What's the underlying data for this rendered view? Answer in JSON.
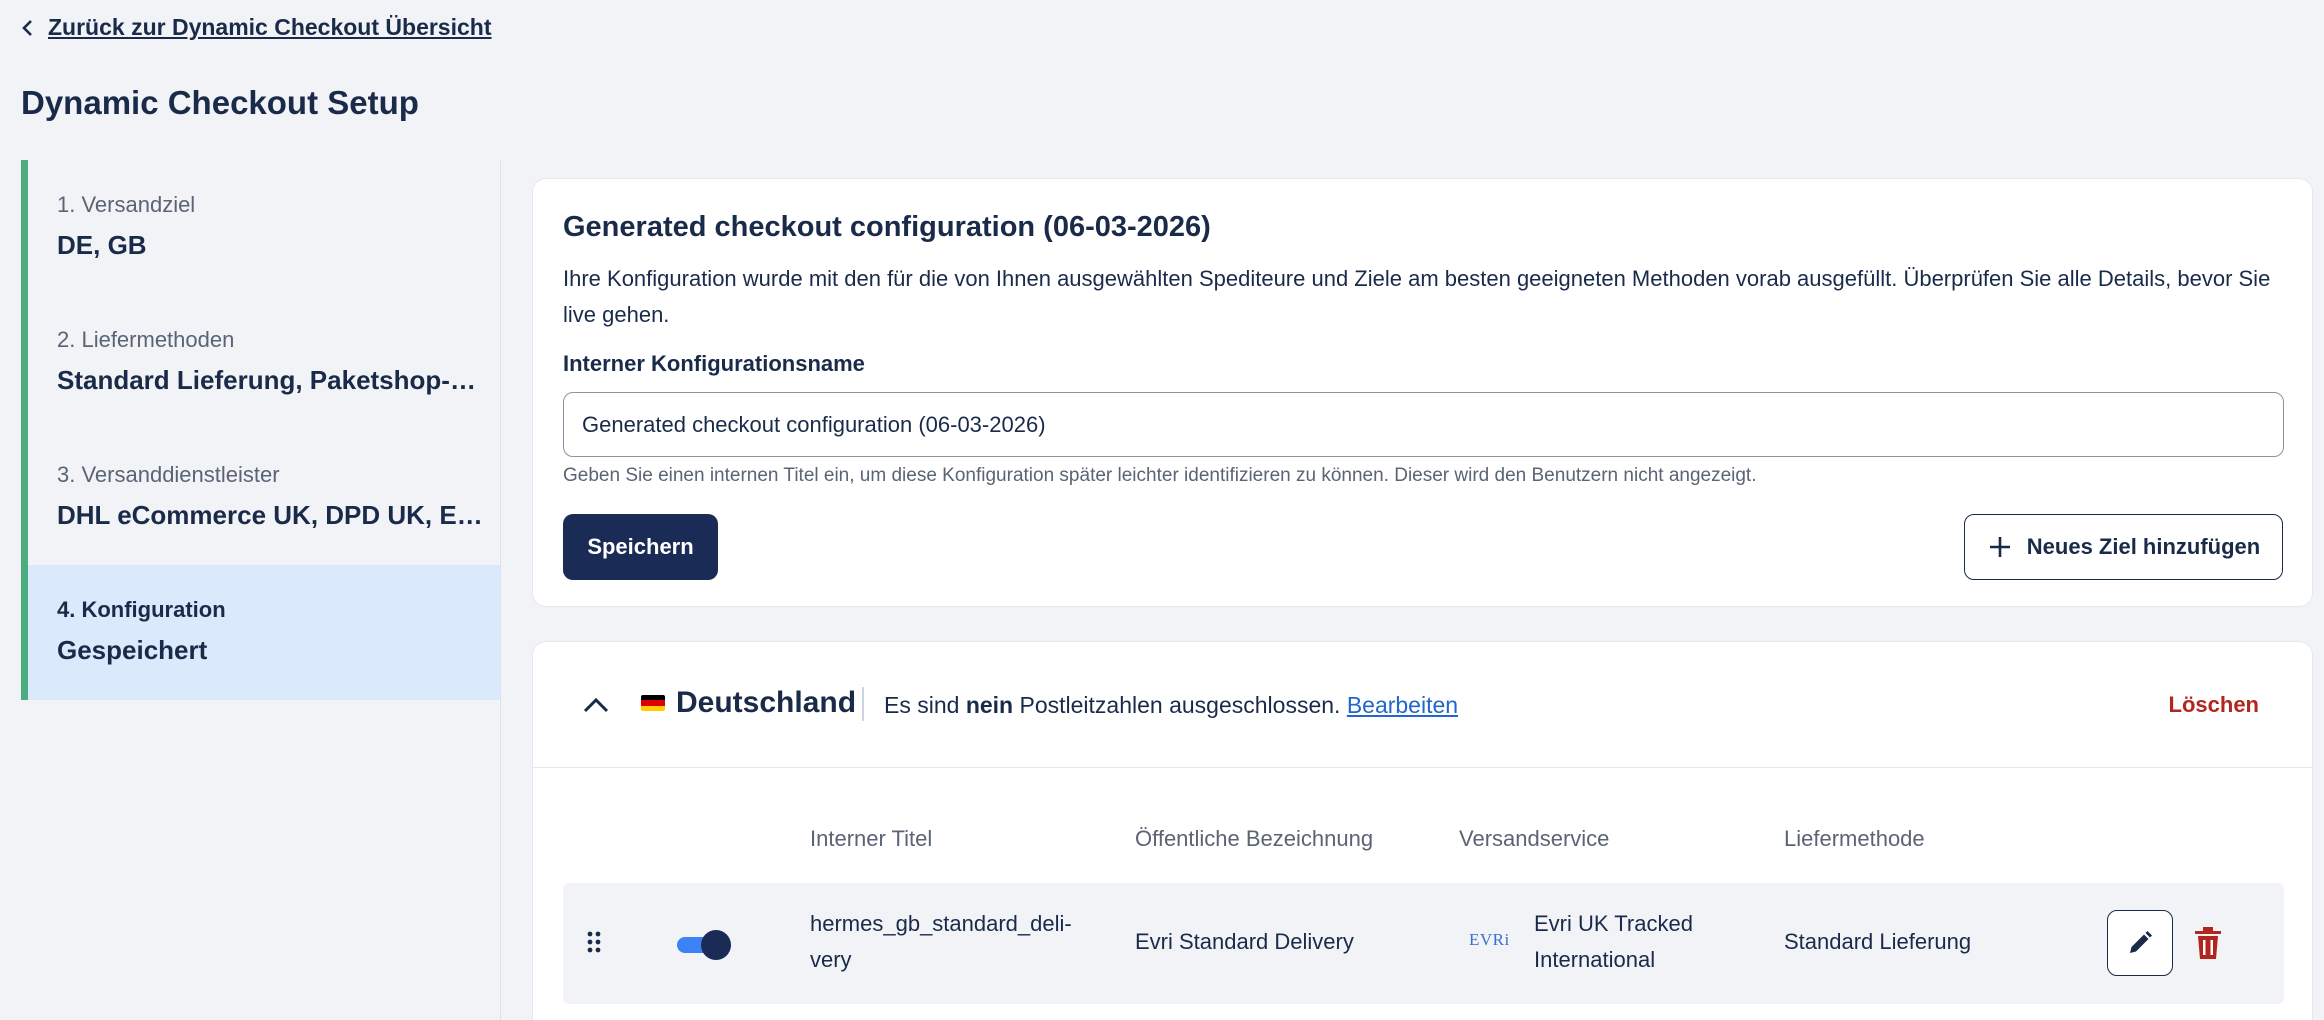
{
  "nav": {
    "back_label": "Zurück zur Dynamic Checkout Übersicht"
  },
  "page": {
    "title": "Dynamic Checkout Setup"
  },
  "steps": [
    {
      "label": "1. Versandziel",
      "value": "DE, GB"
    },
    {
      "label": "2. Liefermethoden",
      "value": "Standard Lieferung, Paketshop-…"
    },
    {
      "label": "3. Versanddienstleister",
      "value": "DHL eCommerce UK, DPD UK, EVRi"
    },
    {
      "label": "4. Konfiguration",
      "value": "Gespeichert",
      "active": true
    }
  ],
  "config": {
    "title": "Generated checkout configuration (06-03-2026)",
    "description": "Ihre Konfiguration wurde mit den für die von Ihnen ausgewählten Spediteure und Ziele am besten geeigneten Methoden vorab ausgefüllt. Überprüfen Sie alle Details, bevor Sie live gehen.",
    "name_label": "Interner Konfigurationsname",
    "name_value": "Generated checkout configuration (06-03-2026)",
    "hint": "Geben Sie einen internen Titel ein, um diese Konfiguration später leichter identifizieren zu können. Dieser wird den Benutzern nicht angezeigt.",
    "save_label": "Speichern",
    "add_label": "Neues Ziel hinzufügen"
  },
  "country": {
    "name": "Deutschland",
    "info_prefix": "Es sind",
    "info_bold": "nein",
    "info_suffix": "Postleitzahlen ausgeschlossen.",
    "edit_link": "Bearbeiten",
    "delete_label": "Löschen",
    "flag_colors": [
      "#000000",
      "#dd0000",
      "#ffce00"
    ],
    "columns": {
      "internal_title": "Interner Titel",
      "public_name": "Öffentliche Bezeichnung",
      "shipping_service": "Versandservice",
      "delivery_method": "Liefermethode"
    },
    "rows": [
      {
        "enabled": true,
        "internal_title": "hermes_gb_standard_deli-\nvery",
        "public_name": "Evri Standard Delivery",
        "carrier_logo": "EVRi",
        "shipping_service": "Evri UK Tracked\nInternational",
        "delivery_method": "Standard Lieferung"
      }
    ]
  },
  "colors": {
    "accent": "#4cae7e",
    "primary": "#1a2b55",
    "danger": "#b3261e",
    "link": "#2266cc",
    "toggle": "#3b82f6"
  }
}
